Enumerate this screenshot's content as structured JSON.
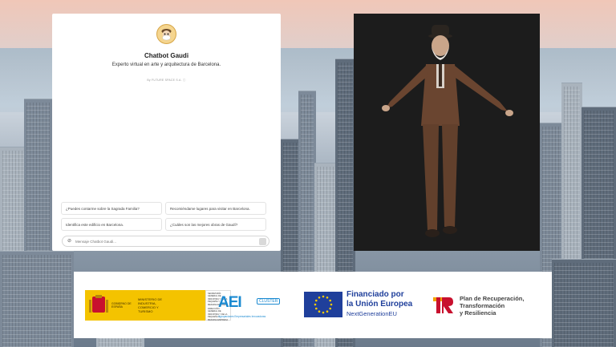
{
  "chat": {
    "title": "Chatbot Gaudi",
    "description": "Experto virtual en arte y arquitectura de Barcelona.",
    "byline": "By FUTURE SPACE S.A. ⓘ",
    "suggestions": [
      "¿Puedes contarme sobre la Sagrada Familia?",
      "Recomiéndame lugares para visitar en Barcelona.",
      "Identifica este edificio en Barcelona.",
      "¿Cuáles son las mejores obras de Gaudí?"
    ],
    "input_placeholder": "Mensaje Chatbot Gaudi..."
  },
  "logos": {
    "gov": {
      "gov_text": "GOBIERNO DE ESPAÑA",
      "ministry_text": "MINISTERIO DE INDUSTRIA, COMERCIO Y TURISMO",
      "side_text_1": "SECRETARÍA GENERAL DE INDUSTRIA Y DE LA PEQUEÑA Y MEDIANA EMPRESA",
      "side_text_2": "DIRECCIÓN GENERAL DE INDUSTRIA Y DE LA PEQUEÑA Y MEDIANA EMPRESA"
    },
    "aei": {
      "mark": "AEI",
      "cluster": "CLUSTER",
      "subtitle": "Agrupaciones Empresariales Innovadoras"
    },
    "eu": {
      "line1": "Financiado por",
      "line2": "la Unión Europea",
      "line3": "NextGenerationEU"
    },
    "recovery": {
      "line1": "Plan de Recuperación,",
      "line2": "Transformación",
      "line3": "y Resiliencia"
    }
  },
  "colors": {
    "gov_yellow": "#f4c300",
    "eu_blue": "#1f3f9b",
    "aei_blue": "#1b8ad1",
    "viewport_bg": "#1c1c1c"
  }
}
